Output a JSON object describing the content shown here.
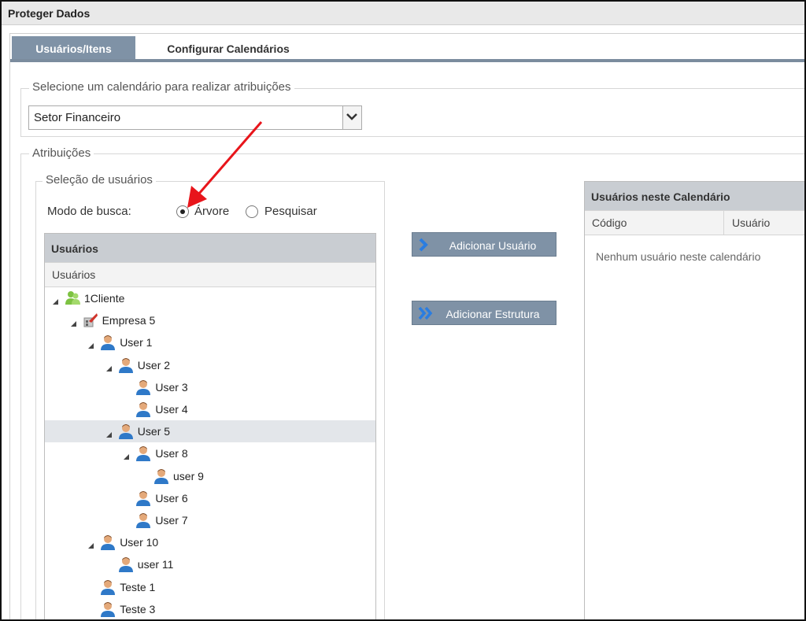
{
  "window": {
    "title": "Proteger Dados"
  },
  "tabs": [
    {
      "label": "Usuários/Itens",
      "active": true
    },
    {
      "label": "Configurar Calendários",
      "active": false
    }
  ],
  "calendar_group": {
    "legend": "Selecione um calendário para realizar atribuições",
    "selected": "Setor Financeiro"
  },
  "assignments": {
    "legend": "Atribuições",
    "user_selection": {
      "legend": "Seleção de usuários",
      "search_mode_label": "Modo de busca:",
      "options": [
        {
          "label": "Árvore",
          "checked": true
        },
        {
          "label": "Pesquisar",
          "checked": false
        }
      ]
    }
  },
  "users_panel": {
    "title": "Usuários",
    "column": "Usuários",
    "tree": [
      {
        "label": "1Cliente",
        "icon": "client-icon",
        "level": 0,
        "expanded": true
      },
      {
        "label": "Empresa 5",
        "icon": "company-icon",
        "level": 1,
        "expanded": true
      },
      {
        "label": "User 1",
        "icon": "user-icon",
        "level": 2,
        "expanded": true
      },
      {
        "label": "User 2",
        "icon": "user-icon",
        "level": 3,
        "expanded": true
      },
      {
        "label": "User 3",
        "icon": "user-icon",
        "level": 4
      },
      {
        "label": "User 4",
        "icon": "user-icon",
        "level": 4
      },
      {
        "label": "User 5",
        "icon": "user-icon",
        "level": 3,
        "expanded": true,
        "selected": true
      },
      {
        "label": "User 8",
        "icon": "user-icon",
        "level": 4,
        "expanded": true
      },
      {
        "label": "user 9",
        "icon": "user-icon",
        "level": 5
      },
      {
        "label": "User 6",
        "icon": "user-icon",
        "level": 4
      },
      {
        "label": "User 7",
        "icon": "user-icon",
        "level": 4
      },
      {
        "label": "User 10",
        "icon": "user-icon",
        "level": 2,
        "expanded": true
      },
      {
        "label": "user 11",
        "icon": "user-icon",
        "level": 3
      },
      {
        "label": "Teste 1",
        "icon": "user-icon",
        "level": 2
      },
      {
        "label": "Teste 3",
        "icon": "user-icon",
        "level": 2
      }
    ]
  },
  "actions": {
    "add_user": "Adicionar Usuário",
    "add_structure": "Adicionar Estrutura"
  },
  "calendar_panel": {
    "title": "Usuários neste Calendário",
    "columns": [
      "Código",
      "Usuário"
    ],
    "empty_text": "Nenhum usuário neste calendário"
  },
  "colors": {
    "accent": "#7f92a6",
    "panel_header": "#c9cdd2",
    "annotation_arrow": "#e8151b"
  }
}
